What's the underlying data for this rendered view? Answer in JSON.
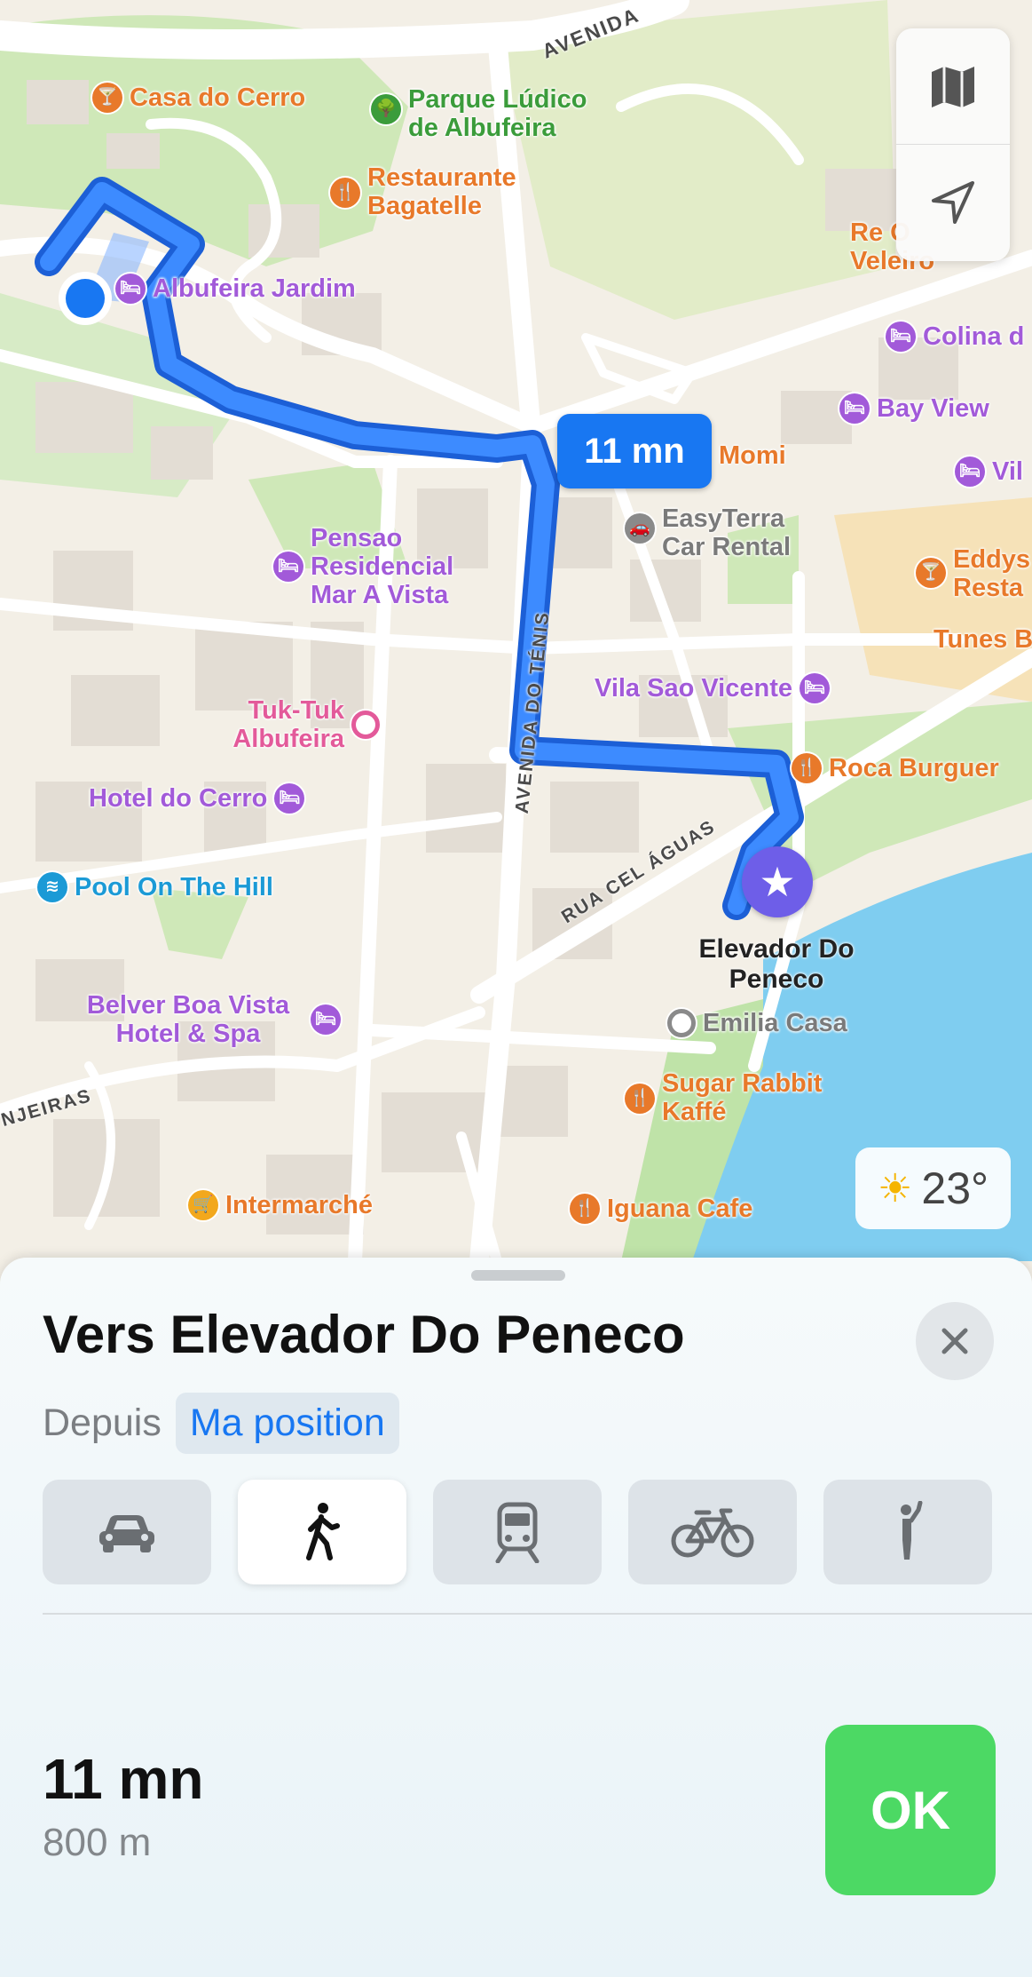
{
  "map": {
    "eta_bubble": "11 mn",
    "weather": {
      "temp": "23°",
      "icon": "sun-icon"
    },
    "destination_label": "Elevador Do Peneco",
    "streets": [
      "AVENIDA",
      "AVENIDA DO TÉNIS",
      "RUA CEL ÁGUAS",
      "NJEIRAS"
    ],
    "pois": [
      {
        "name": "Casa do Cerro",
        "category": "bar",
        "color": "#e8792a"
      },
      {
        "name": "Parque Lúdico de Albufeira",
        "category": "park",
        "color": "#3b9c3b"
      },
      {
        "name": "Restaurante Bagatelle",
        "category": "restaurant",
        "color": "#e8792a"
      },
      {
        "name": "Albufeira Jardim",
        "category": "hotel",
        "color": "#a25ad9"
      },
      {
        "name": "Re O Veleiro",
        "category": "restaurant",
        "color": "#e8792a"
      },
      {
        "name": "Colina d",
        "category": "hotel",
        "color": "#a25ad9"
      },
      {
        "name": "Bay View",
        "category": "hotel",
        "color": "#a25ad9"
      },
      {
        "name": "Momi",
        "category": "restaurant",
        "color": "#e8792a"
      },
      {
        "name": "Vil",
        "category": "hotel",
        "color": "#a25ad9"
      },
      {
        "name": "EasyTerra Car Rental",
        "category": "car",
        "color": "#7a7a7a"
      },
      {
        "name": "Eddys Resta",
        "category": "bar",
        "color": "#e8792a"
      },
      {
        "name": "Pensao Residencial Mar A Vista",
        "category": "hotel",
        "color": "#a25ad9"
      },
      {
        "name": "Tunes B",
        "category": "bar",
        "color": "#e8792a"
      },
      {
        "name": "Vila Sao Vicente",
        "category": "hotel",
        "color": "#a25ad9"
      },
      {
        "name": "Tuk-Tuk Albufeira",
        "category": "attraction",
        "color": "#e35a9a"
      },
      {
        "name": "Roca Burguer",
        "category": "restaurant",
        "color": "#e8792a"
      },
      {
        "name": "Hotel do Cerro",
        "category": "hotel",
        "color": "#a25ad9"
      },
      {
        "name": "Pool On The Hill",
        "category": "pool",
        "color": "#1b9ad6"
      },
      {
        "name": "Belver Boa Vista Hotel & Spa",
        "category": "hotel",
        "color": "#a25ad9"
      },
      {
        "name": "Emilia Casa",
        "category": "place",
        "color": "#7a7a7a"
      },
      {
        "name": "Sugar Rabbit Kaffé",
        "category": "restaurant",
        "color": "#e8792a"
      },
      {
        "name": "Intermarché",
        "category": "shop",
        "color": "#e8792a"
      },
      {
        "name": "Iguana Cafe",
        "category": "restaurant",
        "color": "#e8792a"
      }
    ]
  },
  "sheet": {
    "title": "Vers Elevador Do Peneco",
    "from_label": "Depuis",
    "from_value": "Ma position",
    "modes": [
      {
        "name": "car",
        "icon": "car-icon",
        "active": false
      },
      {
        "name": "walk",
        "icon": "walk-icon",
        "active": true
      },
      {
        "name": "transit",
        "icon": "train-icon",
        "active": false
      },
      {
        "name": "bike",
        "icon": "bike-icon",
        "active": false
      },
      {
        "name": "rideshare",
        "icon": "hail-icon",
        "active": false
      }
    ],
    "duration": "11 mn",
    "distance": "800 m",
    "ok_label": "OK"
  },
  "colors": {
    "route": "#1877f2",
    "accent": "#1877f2",
    "ok": "#4cd964",
    "water": "#7fcdf0",
    "park": "#bfe3a8"
  }
}
